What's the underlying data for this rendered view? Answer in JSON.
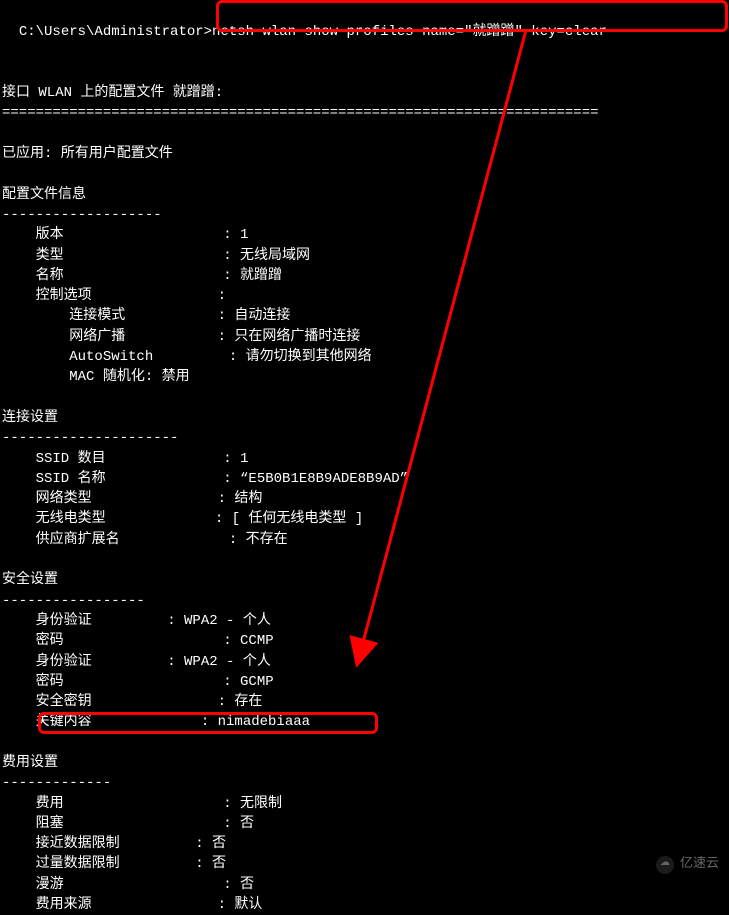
{
  "prompt": "C:\\Users\\Administrator>",
  "command": "netsh wlan show profiles name=\"就蹭蹭\" key=clear",
  "header": {
    "interface_line": "接口 WLAN 上的配置文件 就蹭蹭:",
    "rule": "======================================================================="
  },
  "applied": "已应用: 所有用户配置文件",
  "sections": {
    "profile_info": {
      "title": "配置文件信息",
      "dash": "-------------------",
      "rows": [
        {
          "k": "版本",
          "v": "1",
          "ki": 4,
          "ci": 27
        },
        {
          "k": "类型",
          "v": "无线局域网",
          "ki": 4,
          "ci": 27
        },
        {
          "k": "名称",
          "v": "就蹭蹭",
          "ki": 4,
          "ci": 27
        },
        {
          "k": "控制选项",
          "v": "",
          "ki": 4,
          "ci": 27
        },
        {
          "k": "连接模式",
          "v": "自动连接",
          "ki": 8,
          "ci": 27
        },
        {
          "k": "网络广播",
          "v": "只在网络广播时连接",
          "ki": 8,
          "ci": 27
        },
        {
          "k": "AutoSwitch",
          "v": "请勿切换到其他网络",
          "ki": 8,
          "ci": 27
        },
        {
          "k": "MAC 随机化: 禁用",
          "v": null,
          "ki": 8,
          "ci": 27
        }
      ]
    },
    "conn": {
      "title": "连接设置",
      "dash": "---------------------",
      "rows": [
        {
          "k": "SSID 数目",
          "v": "1",
          "ki": 4,
          "ci": 27
        },
        {
          "k": "SSID 名称",
          "v": "“E5B0B1E8B9ADE8B9AD”",
          "ki": 4,
          "ci": 27
        },
        {
          "k": "网络类型",
          "v": "结构",
          "ki": 4,
          "ci": 27
        },
        {
          "k": "无线电类型",
          "v": "[ 任何无线电类型 ]",
          "ki": 4,
          "ci": 27
        },
        {
          "k": "供应商扩展名",
          "v": "不存在",
          "ki": 4,
          "ci": 29
        }
      ]
    },
    "security": {
      "title": "安全设置",
      "dash": "-----------------",
      "rows": [
        {
          "k": "身份验证",
          "v": "WPA2 - 个人",
          "ki": 4,
          "ci": 21
        },
        {
          "k": "密码",
          "v": "CCMP",
          "ki": 4,
          "ci": 27
        },
        {
          "k": "身份验证",
          "v": "WPA2 - 个人",
          "ki": 4,
          "ci": 21
        },
        {
          "k": "密码",
          "v": "GCMP",
          "ki": 4,
          "ci": 27
        },
        {
          "k": "安全密钥",
          "v": "存在",
          "ki": 4,
          "ci": 27
        },
        {
          "k": "关键内容",
          "v": "nimadebiaaa",
          "ki": 4,
          "ci": 25
        }
      ]
    },
    "cost": {
      "title": "费用设置",
      "dash": "-------------",
      "rows": [
        {
          "k": "费用",
          "v": "无限制",
          "ki": 4,
          "ci": 27
        },
        {
          "k": "阻塞",
          "v": "否",
          "ki": 4,
          "ci": 27
        },
        {
          "k": "接近数据限制",
          "v": "否",
          "ki": 4,
          "ci": 25
        },
        {
          "k": "过量数据限制",
          "v": "否",
          "ki": 4,
          "ci": 25
        },
        {
          "k": "漫游",
          "v": "否",
          "ki": 4,
          "ci": 27
        },
        {
          "k": "费用来源",
          "v": "默认",
          "ki": 4,
          "ci": 27
        }
      ]
    }
  },
  "watermark": "亿速云"
}
